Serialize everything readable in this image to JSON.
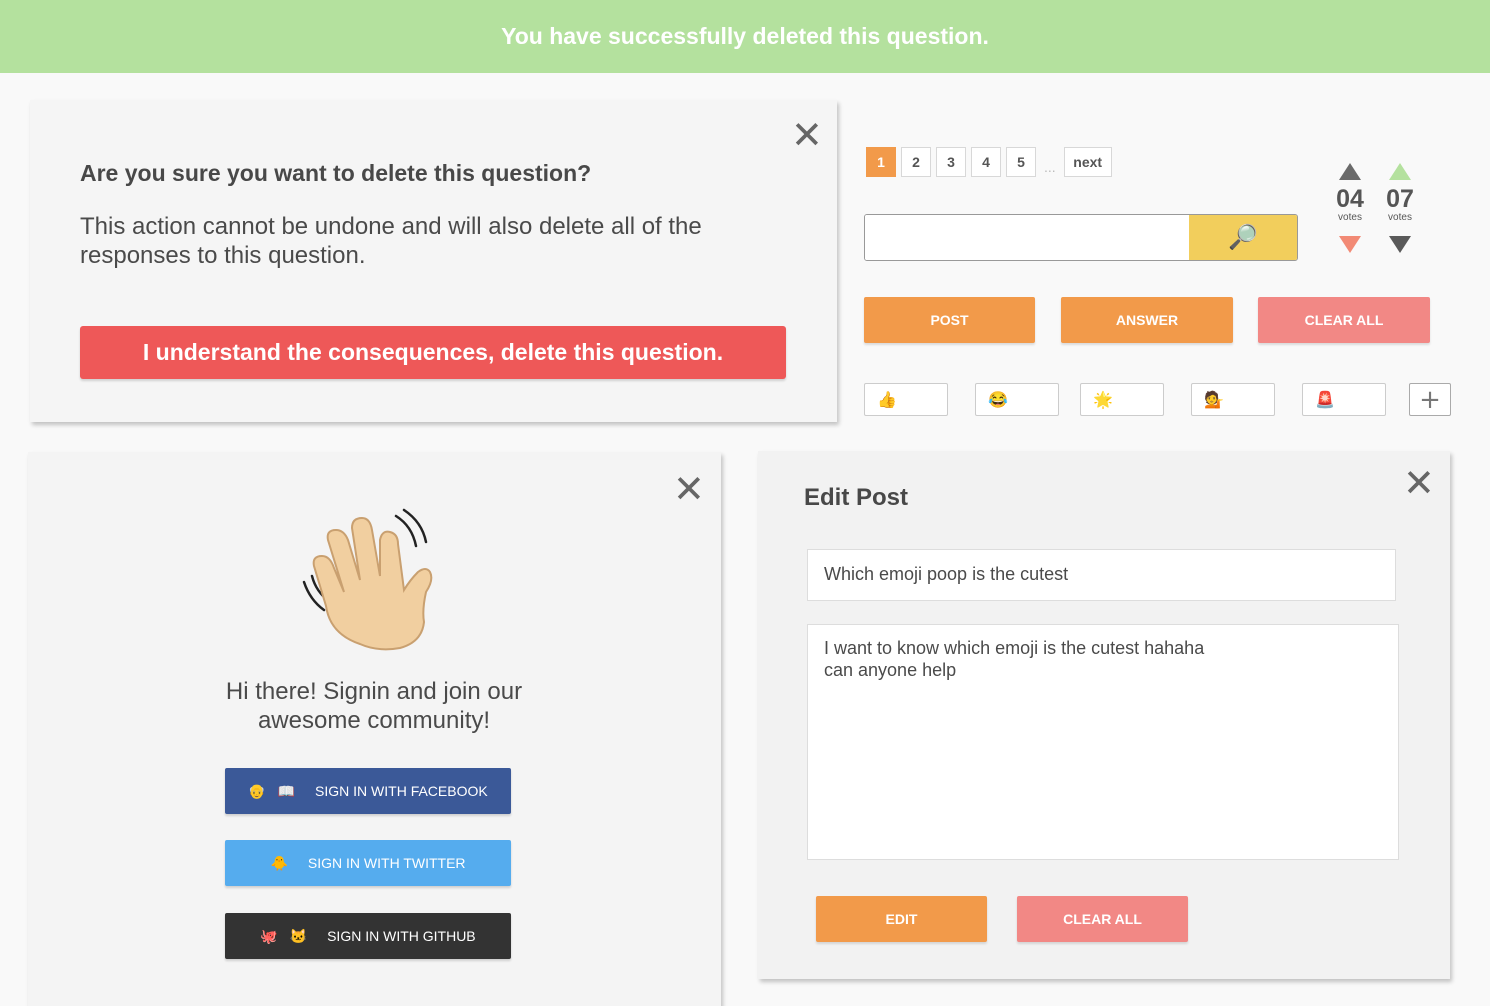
{
  "banner": {
    "message": "You have successfully deleted this question."
  },
  "delete_dialog": {
    "close": "✕",
    "title": "Are you sure you want to delete this question?",
    "description": "This action cannot be undone and will also delete all of the responses to this question.",
    "confirm_label": "I understand the consequences, delete this question."
  },
  "pagination": {
    "pages": [
      "1",
      "2",
      "3",
      "4",
      "5"
    ],
    "active_page": "1",
    "ellipsis": "...",
    "next_label": "next"
  },
  "search": {
    "placeholder": "",
    "value": "",
    "icon": "🔎"
  },
  "votes": [
    {
      "count": "04",
      "label": "votes",
      "up_color": "#6a6a6a",
      "down_color": "#f28a75"
    },
    {
      "count": "07",
      "label": "votes",
      "up_color": "#b4e19e",
      "down_color": "#5a5a5a"
    }
  ],
  "actions": {
    "post_label": "POST",
    "answer_label": "ANSWER",
    "clear_all_label": "CLEAR ALL"
  },
  "reactions": [
    {
      "emoji": "👍",
      "name": "thumbs-up-icon"
    },
    {
      "emoji": "😂",
      "name": "laughing-icon"
    },
    {
      "emoji": "🌟",
      "name": "sparkle-star-icon"
    },
    {
      "emoji": "💁",
      "name": "person-icon"
    },
    {
      "emoji": "🚨",
      "name": "siren-icon"
    }
  ],
  "add_reaction": "+",
  "signin": {
    "close": "✕",
    "wave_icon": "waving-hand-icon",
    "message": "Hi there! Signin and join our awesome community!",
    "facebook": {
      "icons": "👴 📖",
      "label": "SIGN IN WITH FACEBOOK",
      "color": "#3b5998"
    },
    "twitter": {
      "icons": "🐥",
      "label": "SIGN IN WITH TWITTER",
      "color": "#55acee"
    },
    "github": {
      "icons": "🐙 🐱",
      "label": "SIGN IN WITH GITHUB",
      "color": "#333333"
    }
  },
  "edit_post": {
    "close": "✕",
    "title": "Edit Post",
    "post_title_value": "Which emoji poop is the cutest",
    "post_body_value": "I want to know which emoji is the cutest hahaha\ncan anyone help",
    "edit_label": "EDIT",
    "clear_all_label": "CLEAR ALL"
  },
  "colors": {
    "accent_orange": "#f29a4a",
    "danger_red": "#ee5858",
    "soft_red": "#f28885",
    "success_green": "#b4e19e",
    "search_yellow": "#f2ce5c"
  }
}
